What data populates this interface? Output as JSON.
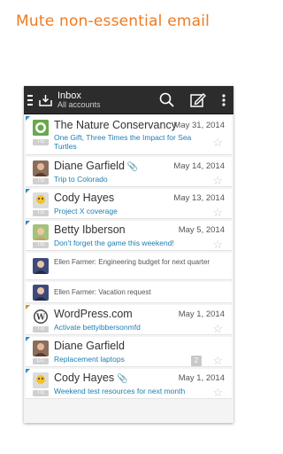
{
  "headline": "Mute non-essential email",
  "appbar": {
    "title": "Inbox",
    "subtitle": "All accounts"
  },
  "messages": [
    {
      "sender": "The Nature Conservancy",
      "date": "May 31, 2014",
      "subject": "One Gift, Three Times the Impact for Sea Turtles",
      "attachment": false
    },
    {
      "sender": "Diane Garfield",
      "date": "May 14, 2014",
      "subject": "Trip to Colorado",
      "attachment": true
    },
    {
      "sender": "Cody Hayes",
      "date": "May 13, 2014",
      "subject": "Project X coverage",
      "attachment": false
    },
    {
      "sender": "Betty Ibberson",
      "date": "May 5, 2014",
      "subject": "Don't forget the game this weekend!",
      "attachment": false
    },
    {
      "sender": "WordPress.com",
      "date": "May 1, 2014",
      "subject": "Activate bettyibbersonmfd",
      "attachment": false
    },
    {
      "sender": "Diane Garfield",
      "date": "May 1, 2014",
      "subject": "Replacement laptops",
      "attachment": false,
      "count": "2"
    },
    {
      "sender": "Cody Hayes",
      "date": "May 1, 2014",
      "subject": "Weekend test resources for next month",
      "attachment": true
    }
  ],
  "muted": [
    {
      "text": "Ellen Farmer: Engineering budget for next quarter"
    },
    {
      "text": "Ellen Farmer: Vacation request"
    }
  ],
  "icons": {
    "star": "☆",
    "clip": "📎"
  },
  "colors": {
    "headline": "#f07a1f",
    "accent": "#2a8fd4",
    "appbar": "#2c2c2c"
  }
}
